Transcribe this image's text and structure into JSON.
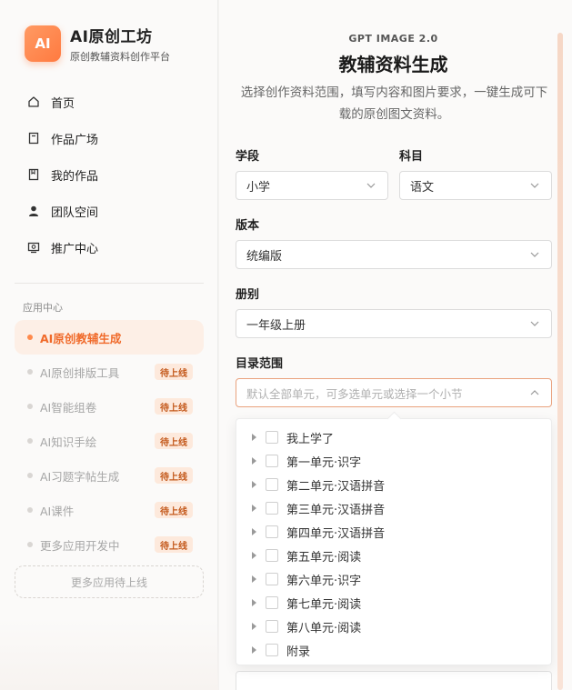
{
  "brand": {
    "logo_text": "AI",
    "title": "AI原创工坊",
    "subtitle": "原创教辅资料创作平台"
  },
  "nav": [
    {
      "label": "首页",
      "icon": "home-icon"
    },
    {
      "label": "作品广场",
      "icon": "book-icon"
    },
    {
      "label": "我的作品",
      "icon": "bookmark-icon"
    },
    {
      "label": "团队空间",
      "icon": "user-icon"
    },
    {
      "label": "推广中心",
      "icon": "promotion-icon"
    }
  ],
  "apps": {
    "section_title": "应用中心",
    "items": [
      {
        "label": "AI原创教辅生成",
        "active": true
      },
      {
        "label": "AI原创排版工具",
        "tag": "待上线"
      },
      {
        "label": "AI智能组卷",
        "tag": "待上线"
      },
      {
        "label": "AI知识手绘",
        "tag": "待上线"
      },
      {
        "label": "AI习题字帖生成",
        "tag": "待上线"
      },
      {
        "label": "AI课件",
        "tag": "待上线"
      },
      {
        "label": "更多应用开发中",
        "tag": "待上线"
      }
    ],
    "more_button": "更多应用待上线"
  },
  "main": {
    "eyebrow": "GPT IMAGE 2.0",
    "title": "教辅资料生成",
    "description": "选择创作资料范围，填写内容和图片要求，一键生成可下载的原创图文资料。",
    "stage": {
      "label": "学段",
      "value": "小学"
    },
    "subject": {
      "label": "科目",
      "value": "语文"
    },
    "edition": {
      "label": "版本",
      "value": "统编版"
    },
    "volume": {
      "label": "册别",
      "value": "一年级上册"
    },
    "catalog": {
      "label": "目录范围",
      "placeholder": "默认全部单元，可多选单元或选择一个小节"
    },
    "tree": [
      "我上学了",
      "第一单元·识字",
      "第二单元·汉语拼音",
      "第三单元·汉语拼音",
      "第四单元·汉语拼音",
      "第五单元·阅读",
      "第六单元·识字",
      "第七单元·阅读",
      "第八单元·阅读",
      "附录"
    ]
  },
  "colors": {
    "accent": "#ff7a40",
    "active_bg": "#fdefe6",
    "tag_bg": "#fde9dc"
  }
}
